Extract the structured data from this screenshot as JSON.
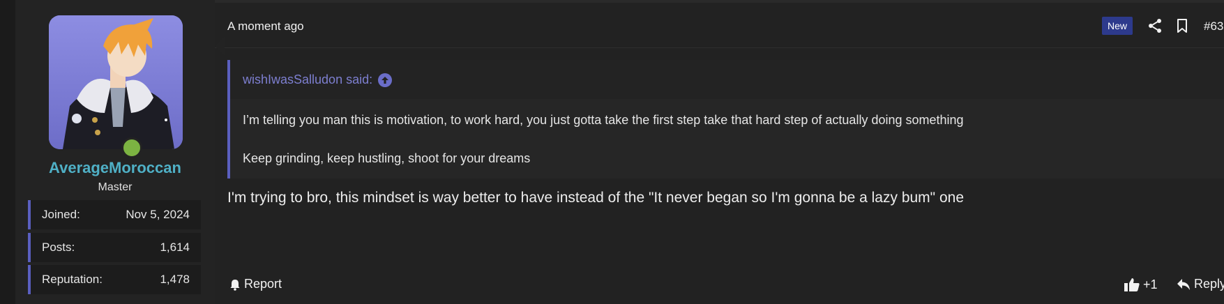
{
  "user": {
    "username": "AverageMoroccan",
    "title": "Master",
    "stats": [
      {
        "label": "Joined:",
        "value": "Nov 5, 2024"
      },
      {
        "label": "Posts:",
        "value": "1,614"
      },
      {
        "label": "Reputation:",
        "value": "1,478"
      }
    ],
    "online_color": "#7cb342"
  },
  "post": {
    "timestamp": "A moment ago",
    "badge": "New",
    "number": "#63",
    "quote": {
      "author": "wishIwasSalludon said:",
      "lines": [
        "I’m telling you man this is motivation, to work hard, you just gotta take the first step take that hard step of actually doing something",
        "Keep grinding, keep hustling, shoot for your dreams"
      ]
    },
    "body": "I'm trying to bro, this mindset is way better to have instead of the \"It never began so I'm gonna be a lazy bum\" one",
    "actions": {
      "report": "Report",
      "like_count": "+1",
      "reply": "Reply"
    }
  },
  "colors": {
    "accent": "#5a5fbf",
    "username": "#4fb0c6",
    "badge_bg": "#2d3a8c"
  }
}
